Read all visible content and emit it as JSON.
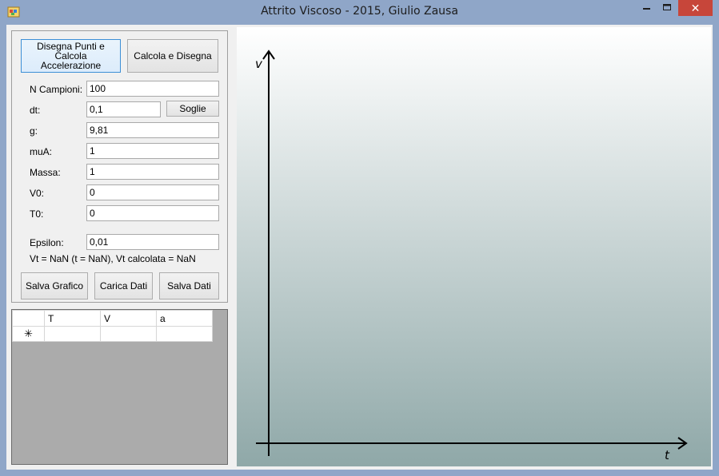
{
  "window": {
    "title": "Attrito Viscoso - 2015, Giulio Zausa"
  },
  "titlebar_buttons": {
    "minimize": "—",
    "maximize": "☐",
    "close": "✕"
  },
  "panel": {
    "btn_draw_points": "Disegna Punti e Calcola Accelerazione",
    "btn_compute_draw": "Calcola e Disegna",
    "fields": [
      {
        "label": "N Campioni:",
        "value": "100"
      },
      {
        "label": "dt:",
        "value": "0,1"
      },
      {
        "label": "g:",
        "value": "9,81"
      },
      {
        "label": "muA:",
        "value": "1"
      },
      {
        "label": "Massa:",
        "value": "1"
      },
      {
        "label": "V0:",
        "value": "0"
      },
      {
        "label": "T0:",
        "value": "0"
      },
      {
        "label": "Epsilon:",
        "value": "0,01"
      }
    ],
    "btn_thresholds": "Soglie",
    "status": "Vt = NaN (t = NaN), Vt calcolata = NaN",
    "btn_save_chart": "Salva Grafico",
    "btn_load_data": "Carica Dati",
    "btn_save_data": "Salva Dati"
  },
  "grid": {
    "columns": [
      "T",
      "V",
      "a"
    ],
    "new_row_marker": "✳"
  },
  "plot": {
    "y_axis_label": "v",
    "x_axis_label": "t"
  }
}
